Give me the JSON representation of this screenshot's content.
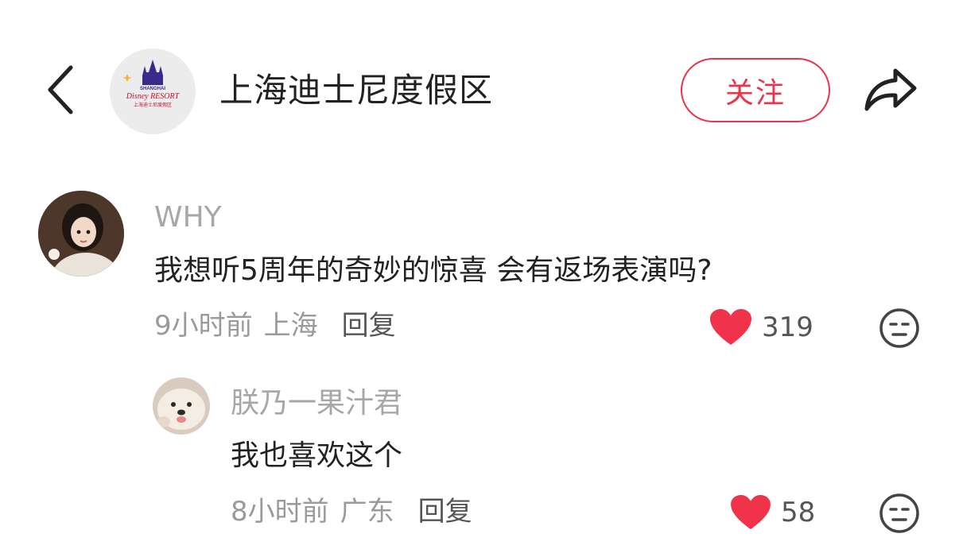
{
  "header": {
    "title": "上海迪士尼度假区",
    "follow_label": "关注",
    "logo": {
      "line1": "SHANGHAI",
      "line2": "Disney RESORT",
      "line3": "上海迪士尼度假区"
    }
  },
  "comments": [
    {
      "username": "WHY",
      "text": "我想听5周年的奇妙的惊喜 会有返场表演吗?",
      "time": "9小时前",
      "location": "上海",
      "reply_label": "回复",
      "likes": "319"
    },
    {
      "username": "朕乃一果汁君",
      "text": "我也喜欢这个",
      "time": "8小时前",
      "location": "广东",
      "reply_label": "回复",
      "likes": "58"
    }
  ],
  "colors": {
    "accent": "#e8344d",
    "heart": "#f0324a",
    "muted": "#9a9a9a"
  }
}
